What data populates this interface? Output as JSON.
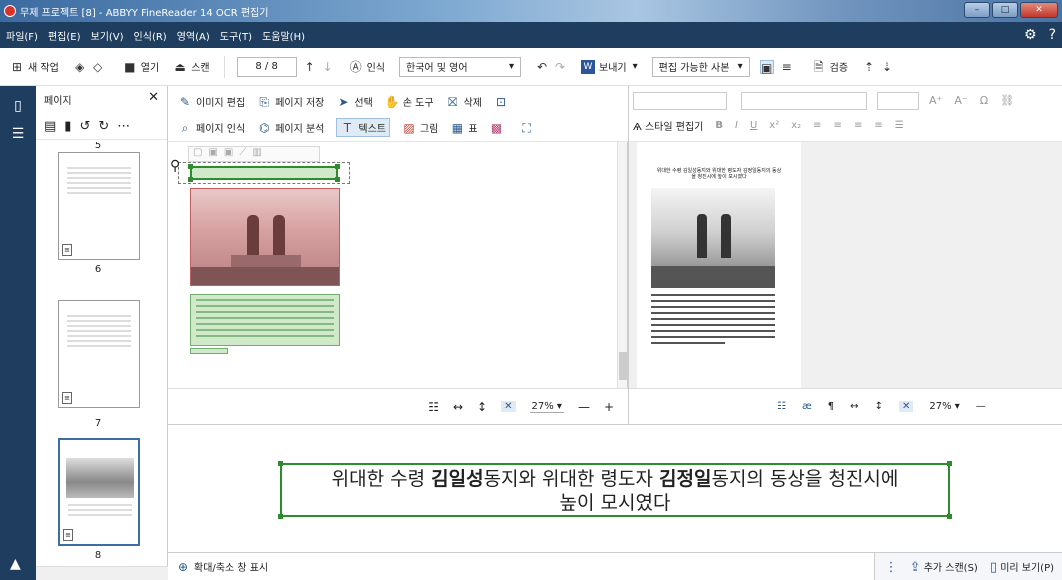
{
  "window": {
    "title": "무제 프로젝트 [8] - ABBYY FineReader 14 OCR 편집기"
  },
  "menu": [
    "파일(F)",
    "편집(E)",
    "보기(V)",
    "인식(R)",
    "영역(A)",
    "도구(T)",
    "도움말(H)"
  ],
  "toolbar": {
    "new_task": "새 작업",
    "open": "열기",
    "scan": "스캔",
    "page_indicator": "8 / 8",
    "recognize": "인식",
    "language": "한국어 및 영어",
    "save": "보내기",
    "save_format": "편집 가능한 사본",
    "verify": "검증"
  },
  "pages_panel": {
    "title": "페이지",
    "page_numbers": [
      "5",
      "6",
      "7",
      "8"
    ]
  },
  "image_panel": {
    "row1": [
      "이미지 편집",
      "페이지 저장",
      "선택",
      "손 도구",
      "삭제"
    ],
    "row2": [
      "페이지 인식",
      "페이지 분석",
      "텍스트",
      "그림",
      "표"
    ],
    "zoom": "27%"
  },
  "text_panel": {
    "style_editor": "스타일 편집기",
    "zoom": "27%",
    "page_header": "위대한 수령 김일성동지와 위대한 령도자 김정일동지의 동상을 청진시에 높이 모시였다"
  },
  "zoom_window": {
    "line1_a": "위대한 수령 ",
    "line1_b": "김일성",
    "line1_c": "동지와 위대한 령도자 ",
    "line1_d": "김정일",
    "line1_e": "동지의 동상을 청진시에",
    "line2": "높이 모시였다"
  },
  "statusbar": {
    "zoom_toggle": "확대/축소 창 표시",
    "add_scan": "추가 스캔(S)",
    "preview": "미리 보기(P)"
  },
  "colors": {
    "nav_dark": "#1e3d5f",
    "zone_green": "#2e8b2e",
    "picture_zone": "#d9a3a3"
  }
}
